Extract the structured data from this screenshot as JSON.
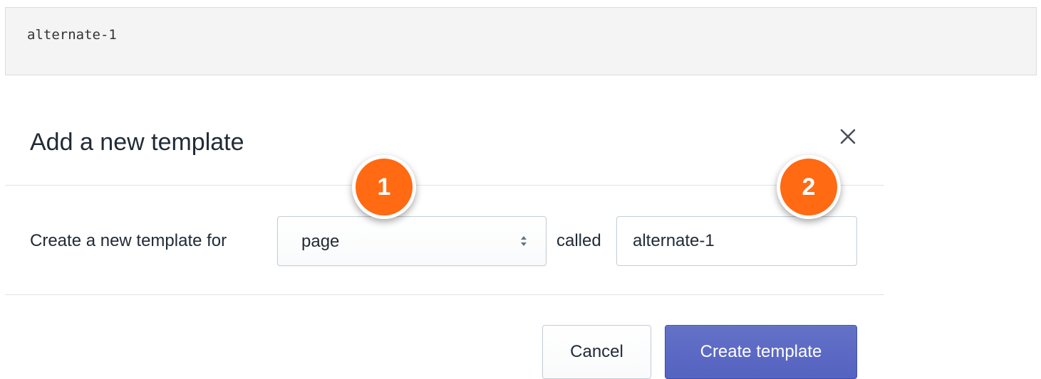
{
  "code_block": {
    "text": "alternate-1"
  },
  "modal": {
    "title": "Add a new template",
    "close_icon": "close-icon",
    "form": {
      "label": "Create a new template for",
      "select_value": "page",
      "called_label": "called",
      "name_value": "alternate-1"
    },
    "badges": [
      "1",
      "2"
    ],
    "buttons": {
      "cancel": "Cancel",
      "create": "Create template"
    }
  },
  "colors": {
    "badge": "#ff6a13",
    "primary_button": "#5c6ac4",
    "divider": "#dfe3e8"
  }
}
